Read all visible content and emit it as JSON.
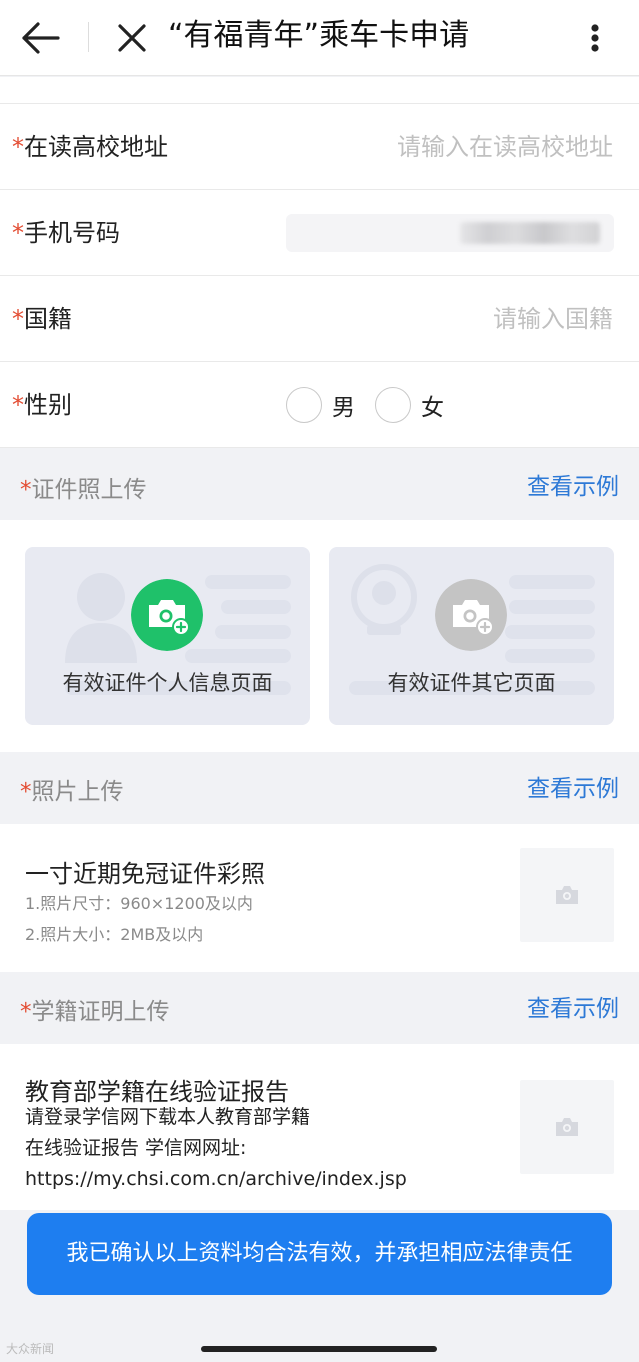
{
  "header": {
    "title": "“有福青年”乘车卡申请",
    "back_icon": "arrow-left-icon",
    "close_icon": "close-icon",
    "more_icon": "more-vertical-icon"
  },
  "form": {
    "star": "*",
    "school_address": {
      "label": "在读高校地址",
      "placeholder": "请输入在读高校地址"
    },
    "phone": {
      "label": "手机号码"
    },
    "nationality": {
      "label": "国籍",
      "placeholder": "请输入国籍"
    },
    "gender": {
      "label": "性别",
      "options": [
        "男",
        "女"
      ]
    }
  },
  "id_upload": {
    "title": "证件照上传",
    "example_link": "查看示例",
    "cards": [
      {
        "caption": "有效证件个人信息页面",
        "icon": "camera-add-icon",
        "color": "#1fc16a"
      },
      {
        "caption": "有效证件其它页面",
        "icon": "camera-add-icon",
        "color": "#c4c4c4"
      }
    ]
  },
  "photo_upload": {
    "title": "照片上传",
    "example_link": "查看示例",
    "item_title": "一寸近期免冠证件彩照",
    "notes": [
      "1.照片尺寸：960×1200及以内",
      "2.照片大小：2MB及以内"
    ]
  },
  "enrollment_upload": {
    "title": "学籍证明上传",
    "example_link": "查看示例",
    "item_title": "教育部学籍在线验证报告",
    "lines": [
      "请登录学信网下载本人教育部学籍",
      "在线验证报告 学信网网址:",
      "https://my.chsi.com.cn/archive/index.jsp"
    ]
  },
  "confirm_button": "我已确认以上资料均合法有效，并承担相应法律责任",
  "watermark": "大众新闻",
  "colors": {
    "accent": "#1e7ef0",
    "link": "#2d79d6",
    "required": "#e34d33",
    "camera_green": "#1fc16a"
  }
}
